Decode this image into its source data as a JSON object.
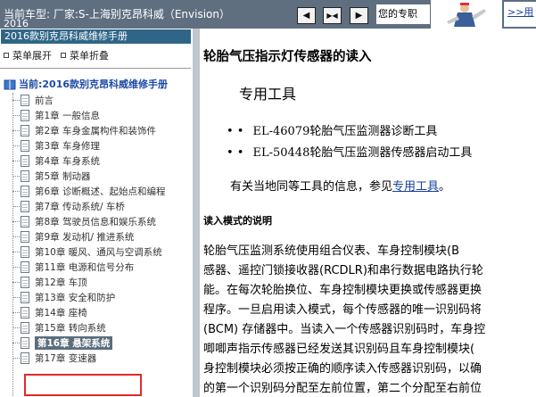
{
  "header": {
    "vehicle_label": "当前车型:  厂家:S-上海别克昂科威（Envision）",
    "year": "2016",
    "nav_buttons": [
      "back",
      "expand",
      "forward"
    ],
    "expert_text": "您的专职",
    "more_link": ">>用"
  },
  "sidebar": {
    "manual_title": "2016款别克昂科威维修手册",
    "expand_all": "菜单展开",
    "collapse_all": "菜单折叠",
    "current": "当前:2016款别克昂科威维修手册",
    "items": [
      {
        "label": "前言"
      },
      {
        "label": "第1章 一般信息"
      },
      {
        "label": "第2章 车身金属构件和装饰件"
      },
      {
        "label": "第3章 车身修理"
      },
      {
        "label": "第4章 车身系统"
      },
      {
        "label": "第5章 制动器"
      },
      {
        "label": "第6章 诊断概述、起始点和编程"
      },
      {
        "label": "第7章 传动系统/ 车桥"
      },
      {
        "label": "第8章 驾驶员信息和娱乐系统"
      },
      {
        "label": "第9章 发动机/ 推进系统"
      },
      {
        "label": "第10章 暖风、通风与空调系统"
      },
      {
        "label": "第11章 电源和信号分布"
      },
      {
        "label": "第12章 车顶"
      },
      {
        "label": "第13章 安全和防护"
      },
      {
        "label": "第14章 座椅"
      },
      {
        "label": "第15章 转向系统"
      },
      {
        "label": "第16章 悬架系统"
      },
      {
        "label": "第17章 变速器"
      }
    ],
    "selected_index": 16
  },
  "content": {
    "title": "轮胎气压指示灯传感器的读入",
    "tools_heading": "专用工具",
    "tools": [
      "EL-46079轮胎气压监测器诊断工具",
      "EL-50448轮胎气压监测器传感器启动工具"
    ],
    "ref_text": "有关当地同等工具的信息，参见",
    "ref_link": "专用工具",
    "ref_end": "。",
    "mode_heading": "读入模式的说明",
    "paragraph_lines": [
      "      轮胎气压监测系统使用组合仪表、车身控制模块(B",
      "感器、遥控门锁接收器(RCDLR)和串行数据电路执行轮",
      "能。在每次轮胎换位、车身控制模块更换或传感器更换",
      "程序。一旦启用读入模式，每个传感器的唯一识别码将",
      "(BCM) 存储器中。当读入一个传感器识别码时，车身控",
      "唧唧声指示传感器已经发送其识别码且车身控制模块(",
      "身控制模块必须按正确的顺序读入传感器识别码，以确",
      "的第一个识别码分配至左前位置，第二个分配至右前位"
    ]
  },
  "colors": {
    "topbar": "#5f6f80",
    "title_bar": "#2f6688",
    "selected": "#5c6d7c",
    "highlight_box": "#e22a2a",
    "link": "#1a3f9e"
  }
}
